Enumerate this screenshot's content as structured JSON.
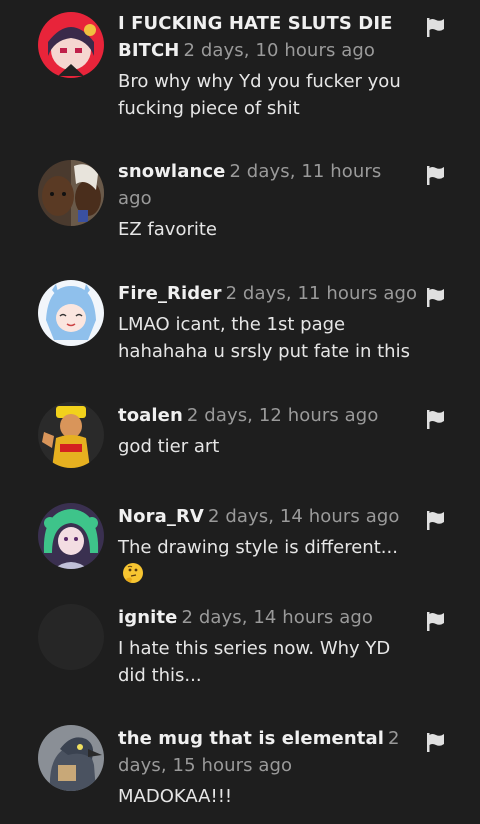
{
  "comments": [
    {
      "username": "I FUCKING HATE SLUTS DIE BITCH",
      "time": "2 days, 10 hours ago",
      "text": "Bro why why Yd you fucker you fucking piece of shit",
      "avatar": "anime-girl-red-avatar",
      "flag_icon": "flag-icon"
    },
    {
      "username": "snowlance",
      "time": "2 days, 11 hours ago",
      "text": "EZ favorite",
      "avatar": "two-men-photo-avatar",
      "flag_icon": "flag-icon"
    },
    {
      "username": "Fire_Rider",
      "time": "2 days, 11 hours ago",
      "text": "LMAO icant, the 1st page hahahaha u srsly put fate in this",
      "avatar": "anime-girl-blue-hair-avatar",
      "flag_icon": "flag-icon"
    },
    {
      "username": "toalen",
      "time": "2 days, 12 hours ago",
      "text": "god tier art",
      "avatar": "wrestler-photo-avatar",
      "flag_icon": "flag-icon"
    },
    {
      "username": "Nora_RV",
      "time": "2 days, 14 hours ago",
      "text": "The drawing style is different...",
      "emoji": "thinking-face-emoji",
      "avatar": "anime-girl-green-hair-avatar",
      "flag_icon": "flag-icon"
    },
    {
      "username": "ignite",
      "time": "2 days, 14 hours ago",
      "text": "I hate this series now. Why YD did this...",
      "avatar": "blank-avatar",
      "flag_icon": "flag-icon"
    },
    {
      "username": "the mug that is elemental",
      "time": "2 days, 15 hours ago",
      "text": "MADOKAA!!!",
      "avatar": "bird-photo-avatar",
      "flag_icon": "flag-icon"
    }
  ],
  "colors": {
    "background": "#1e1e1e",
    "username": "#f0f0f0",
    "timestamp": "#9a9a9a",
    "text": "#e6e6e6",
    "flag": "#e0e0e0"
  }
}
